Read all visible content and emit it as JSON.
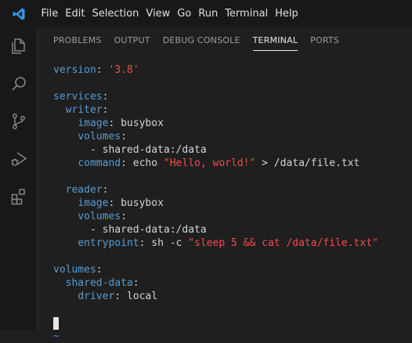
{
  "menubar": {
    "logo": "vscode-logo-icon",
    "items": [
      "File",
      "Edit",
      "Selection",
      "View",
      "Go",
      "Run",
      "Terminal",
      "Help"
    ]
  },
  "activitybar": [
    "files-icon",
    "search-icon",
    "source-control-icon",
    "run-debug-icon",
    "extensions-icon"
  ],
  "panel": {
    "tabs": [
      "PROBLEMS",
      "OUTPUT",
      "DEBUG CONSOLE",
      "TERMINAL",
      "PORTS"
    ],
    "active_tab": "TERMINAL"
  },
  "terminal": {
    "l1": {
      "key": "version",
      "colon": ": ",
      "val": "'3.8'"
    },
    "l3": {
      "key": "services",
      "colon": ":"
    },
    "l4": {
      "indent": "  ",
      "key": "writer",
      "colon": ":"
    },
    "l5": {
      "indent": "    ",
      "key": "image",
      "colon": ": ",
      "val": "busybox"
    },
    "l6": {
      "indent": "    ",
      "key": "volumes",
      "colon": ":"
    },
    "l7": {
      "indent": "      ",
      "text": "- shared-data:/data"
    },
    "l8": {
      "indent": "    ",
      "key": "command",
      "colon": ": ",
      "plain": "echo ",
      "str": "\"Hello, world!\"",
      "rest": " > /data/file.txt"
    },
    "l10": {
      "indent": "  ",
      "key": "reader",
      "colon": ":"
    },
    "l11": {
      "indent": "    ",
      "key": "image",
      "colon": ": ",
      "val": "busybox"
    },
    "l12": {
      "indent": "    ",
      "key": "volumes",
      "colon": ":"
    },
    "l13": {
      "indent": "      ",
      "text": "- shared-data:/data"
    },
    "l14": {
      "indent": "    ",
      "key": "entrypoint",
      "colon": ": ",
      "plain": "sh -c ",
      "str": "\"sleep 5 && cat /data/file.txt\""
    },
    "l16": {
      "key": "volumes",
      "colon": ":"
    },
    "l17": {
      "indent": "  ",
      "key": "shared-data",
      "colon": ":"
    },
    "l18": {
      "indent": "    ",
      "key": "driver",
      "colon": ": ",
      "val": "local"
    },
    "tilde": "~"
  }
}
